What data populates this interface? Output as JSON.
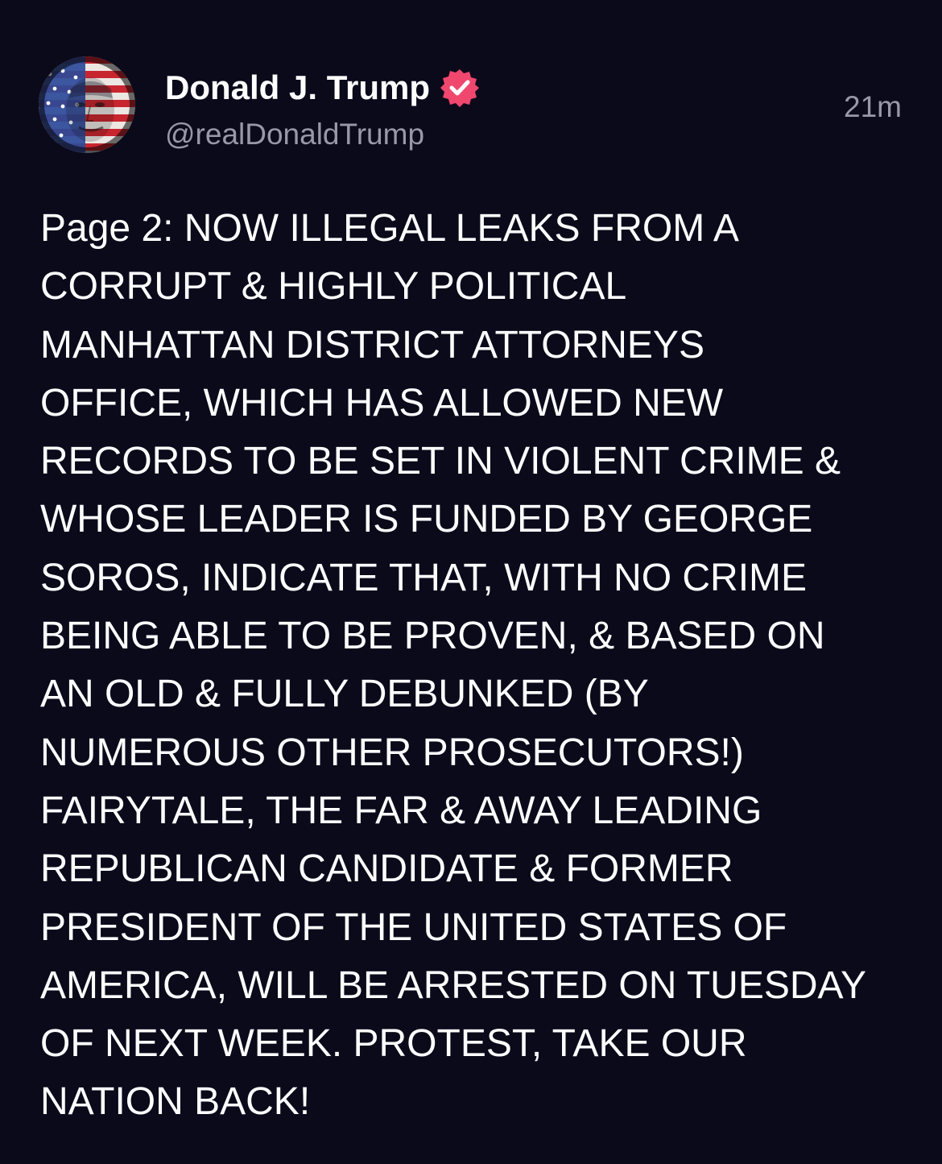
{
  "post": {
    "author": {
      "display_name": "Donald J. Trump",
      "handle": "@realDonaldTrump",
      "verified": true,
      "verified_badge_icon": "verified-badge-icon",
      "avatar_icon": "profile-avatar-flag-portrait"
    },
    "timestamp": "21m",
    "text": "Page 2: NOW ILLEGAL LEAKS FROM A\nCORRUPT & HIGHLY POLITICAL\nMANHATTAN DISTRICT ATTORNEYS\nOFFICE, WHICH HAS ALLOWED NEW\nRECORDS TO BE SET IN VIOLENT CRIME &\nWHOSE LEADER IS FUNDED BY GEORGE\nSOROS, INDICATE THAT, WITH NO CRIME\nBEING ABLE TO BE PROVEN, & BASED ON\nAN OLD & FULLY DEBUNKED (BY\nNUMEROUS OTHER PROSECUTORS!)\nFAIRYTALE, THE FAR & AWAY LEADING\nREPUBLICAN CANDIDATE & FORMER\nPRESIDENT OF THE UNITED STATES OF\nAMERICA, WILL BE ARRESTED ON TUESDAY\nOF NEXT WEEK. PROTEST, TAKE OUR\nNATION BACK!"
  },
  "colors": {
    "background": "#0b0a1b",
    "text_primary": "#ffffff",
    "text_secondary": "#9a98a8",
    "verified_badge": "#f0476e"
  }
}
